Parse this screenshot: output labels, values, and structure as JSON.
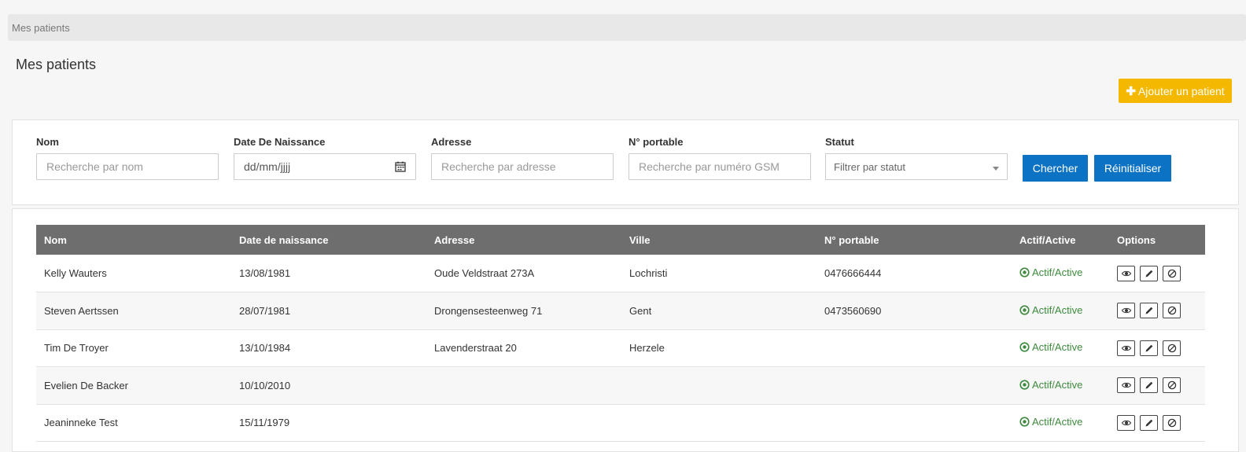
{
  "breadcrumb": "Mes patients",
  "page_title": "Mes patients",
  "add_button": {
    "icon": "plus-icon",
    "label": "Ajouter un patient",
    "color": "#f5b800"
  },
  "filters": {
    "name": {
      "label": "Nom",
      "placeholder": "Recherche par nom"
    },
    "birthdate": {
      "label": "Date De Naissance",
      "placeholder": "dd/mm/jjjj"
    },
    "address": {
      "label": "Adresse",
      "placeholder": "Recherche par adresse"
    },
    "mobile": {
      "label": "N° portable",
      "placeholder": "Recherche par numéro GSM"
    },
    "status": {
      "label": "Statut",
      "placeholder": "Filtrer par statut"
    },
    "search_label": "Chercher",
    "reset_label": "Réinitialiser",
    "button_color": "#0b72c4"
  },
  "table": {
    "headers": [
      "Nom",
      "Date de naissance",
      "Adresse",
      "Ville",
      "N° portable",
      "Actif/Active",
      "Options"
    ],
    "rows": [
      {
        "name": "Kelly Wauters",
        "birthdate": "13/08/1981",
        "address": "Oude Veldstraat 273A",
        "city": "Lochristi",
        "mobile": "0476666444",
        "status": "Actif/Active"
      },
      {
        "name": "Steven Aertssen",
        "birthdate": "28/07/1981",
        "address": "Drongensesteenweg 71",
        "city": "Gent",
        "mobile": "0473560690",
        "status": "Actif/Active"
      },
      {
        "name": "Tim De Troyer",
        "birthdate": "13/10/1984",
        "address": "Lavenderstraat 20",
        "city": "Herzele",
        "mobile": "",
        "status": "Actif/Active"
      },
      {
        "name": "Evelien De Backer",
        "birthdate": "10/10/2010",
        "address": "",
        "city": "",
        "mobile": "",
        "status": "Actif/Active"
      },
      {
        "name": "Jeaninneke Test",
        "birthdate": "15/11/1979",
        "address": "",
        "city": "",
        "mobile": "",
        "status": "Actif/Active"
      }
    ],
    "option_icons": [
      "eye-icon",
      "pencil-icon",
      "ban-icon"
    ],
    "header_color": "#6e6e6e",
    "status_color": "#3d8a3d"
  }
}
